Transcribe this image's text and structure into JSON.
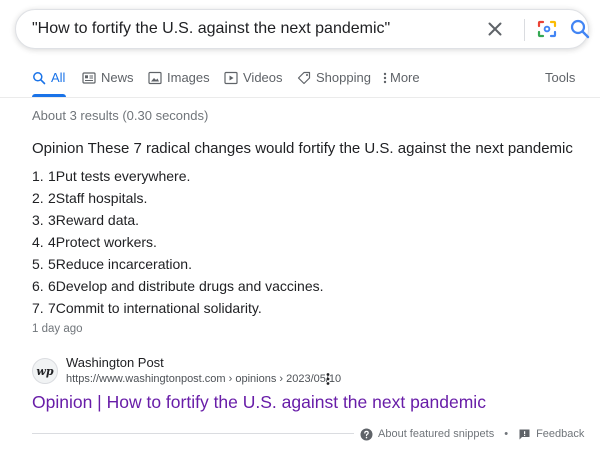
{
  "search": {
    "query": "\"How to fortify the U.S. against the next pandemic\""
  },
  "tabs": [
    {
      "label": "All",
      "icon": "search-icon",
      "active": true
    },
    {
      "label": "News",
      "icon": "news-icon"
    },
    {
      "label": "Images",
      "icon": "image-icon"
    },
    {
      "label": "Videos",
      "icon": "video-icon"
    },
    {
      "label": "Shopping",
      "icon": "tag-icon"
    },
    {
      "label": "More",
      "icon": "more-vert-icon"
    },
    {
      "label": "Tools"
    }
  ],
  "result_stats": "About 3 results (0.30 seconds)",
  "snippet": {
    "heading": "Opinion These 7 radical changes would fortify the U.S. against the next pandemic",
    "items": [
      {
        "num": "1.",
        "text": "1Put tests everywhere."
      },
      {
        "num": "2.",
        "text": "2Staff hospitals."
      },
      {
        "num": "3.",
        "text": "3Reward data."
      },
      {
        "num": "4.",
        "text": "4Protect workers."
      },
      {
        "num": "5.",
        "text": "5Reduce incarceration."
      },
      {
        "num": "6.",
        "text": "6Develop and distribute drugs and vaccines."
      },
      {
        "num": "7.",
        "text": "7Commit to international solidarity."
      }
    ],
    "date": "1 day ago"
  },
  "source": {
    "favicon_text": "wp",
    "site_name": "Washington Post",
    "url": "https://www.washingtonpost.com › opinions › 2023/05/10"
  },
  "result_title": "Opinion | How to fortify the U.S. against the next pandemic",
  "footer": {
    "about": "About featured snippets",
    "separator": "•",
    "feedback": "Feedback"
  },
  "colors": {
    "accent": "#1a73e8",
    "visited_link": "#681da8",
    "secondary_text": "#70757a"
  }
}
